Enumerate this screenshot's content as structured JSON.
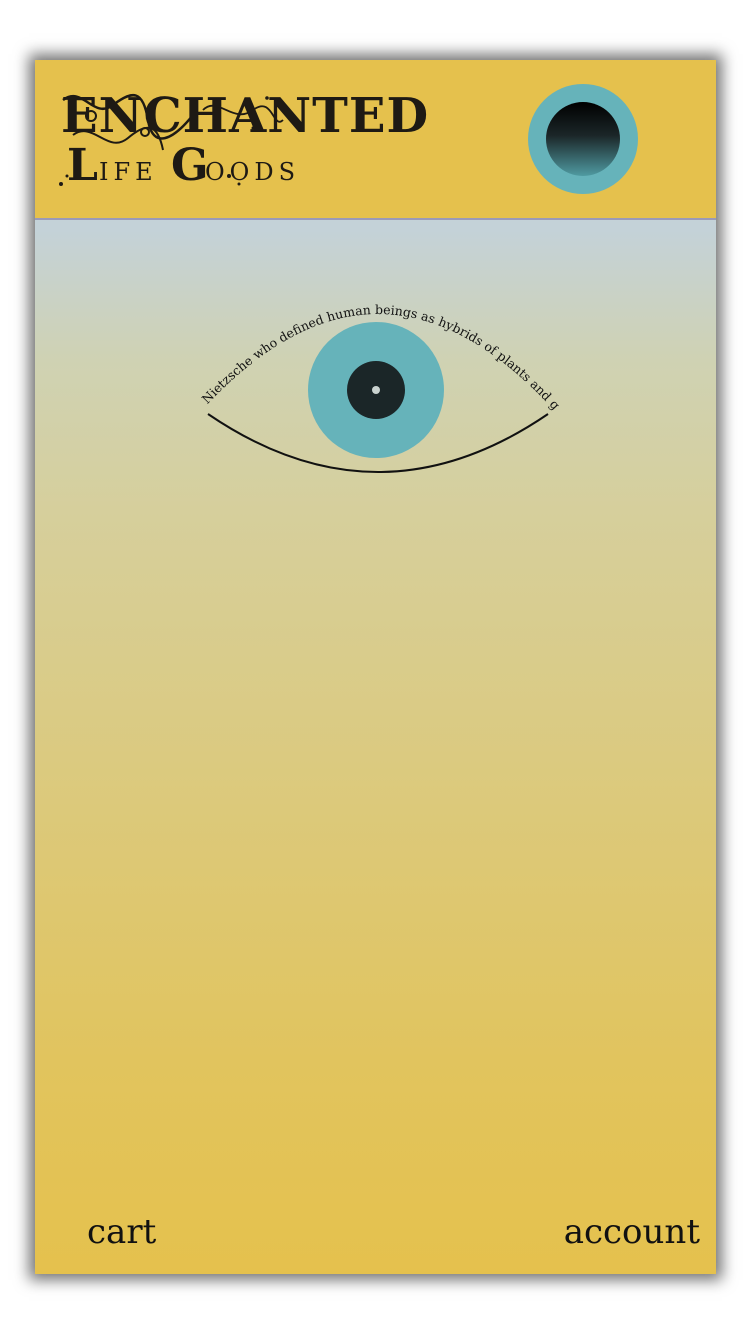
{
  "header": {
    "logo": {
      "line1": "Enchanted",
      "line2": "Life Goods"
    },
    "menu_icon": "eye-orb-icon"
  },
  "main": {
    "quote": "it was Nietzsche who defined human beings as hybrids of plants and ghosts",
    "illustration": "eye-icon"
  },
  "footer": {
    "cart_label": "cart",
    "account_label": "account"
  },
  "colors": {
    "header_bg": "#e5c14d",
    "iris": "#66b3ba",
    "pupil": "#1b2628",
    "sky_top": "#c4d2d8",
    "gold_bottom": "#e5c14d"
  }
}
